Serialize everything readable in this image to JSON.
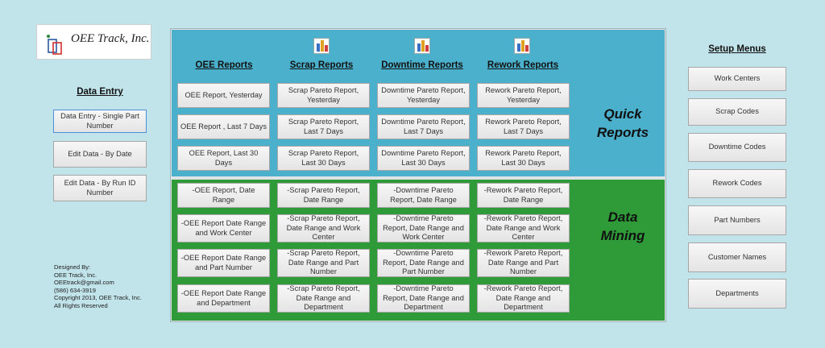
{
  "logo": {
    "name": "OEE Track, Inc."
  },
  "data_entry": {
    "title": "Data Entry",
    "buttons": [
      "Data Entry - Single Part Number",
      "Edit Data - By Date",
      "Edit Data - By Run ID Number"
    ]
  },
  "credits": {
    "lines": [
      "Designed By:",
      "OEE Track, Inc.",
      "OEEtrack@gmail.com",
      "(586) 634-3919",
      "Copyright 2013, OEE Track, Inc.",
      "All Rights Reserved"
    ]
  },
  "columns": {
    "headers": [
      "OEE Reports",
      "Scrap Reports",
      "Downtime Reports",
      "Rework Reports"
    ]
  },
  "quick_reports": {
    "label_line1": "Quick",
    "label_line2": "Reports",
    "rows": [
      [
        "OEE Report, Yesterday",
        "Scrap Pareto Report, Yesterday",
        "Downtime Pareto Report, Yesterday",
        "Rework Pareto Report, Yesterday"
      ],
      [
        "OEE Report , Last 7 Days",
        "Scrap Pareto Report, Last 7 Days",
        "Downtime Pareto Report, Last 7 Days",
        "Rework Pareto Report, Last 7 Days"
      ],
      [
        "OEE Report, Last 30 Days",
        "Scrap Pareto Report, Last 30 Days",
        "Downtime Pareto Report, Last 30 Days",
        "Rework Pareto Report, Last 30 Days"
      ]
    ]
  },
  "data_mining": {
    "label_line1": "Data",
    "label_line2": "Mining",
    "rows": [
      [
        "-OEE Report, Date Range",
        "-Scrap Pareto Report, Date Range",
        "-Downtime Pareto Report, Date Range",
        "-Rework Pareto Report, Date Range"
      ],
      [
        "-OEE Report Date Range and Work Center",
        "-Scrap Pareto Report, Date Range and Work Center",
        "-Downtime Pareto Report, Date Range and Work Center",
        "-Rework Pareto Report, Date Range and Work Center"
      ],
      [
        "-OEE Report Date Range and Part Number",
        "-Scrap Pareto Report, Date Range and Part Number",
        "-Downtime Pareto Report, Date Range and Part Number",
        "-Rework Pareto Report, Date Range and Part Number"
      ],
      [
        "-OEE Report Date Range and Department",
        "-Scrap Pareto Report, Date Range and Department",
        "-Downtime Pareto Report, Date Range and Department",
        "-Rework Pareto Report, Date Range and Department"
      ]
    ]
  },
  "setup": {
    "title": "Setup Menus",
    "buttons": [
      "Work Centers",
      "Scrap Codes",
      "Downtime Codes",
      "Rework Codes",
      "Part Numbers",
      "Customer Names",
      "Departments"
    ]
  },
  "icons": {
    "report_icon": "bar-chart-icon"
  },
  "colors": {
    "background": "#c1e3ea",
    "quick_reports_bg": "#4bb0cc",
    "data_mining_bg": "#2f9a38",
    "button_bg": "#ececec",
    "selected_border": "#4c90d8"
  }
}
